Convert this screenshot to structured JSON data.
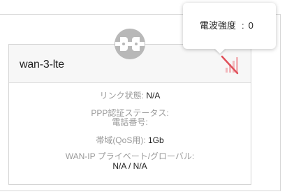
{
  "card": {
    "title": "wan-3-lte"
  },
  "info": {
    "link_status_label": "リンク状態:",
    "link_status_value": "N/A",
    "ppp_auth_label": "PPP認証ステータス:",
    "phone_number_label": "電話番号:",
    "bandwidth_label": "帯域(QoS用):",
    "bandwidth_value": "1Gb",
    "wan_ip_label": "WAN-IP プライベート/グローバル:",
    "wan_ip_value": "N/A / N/A"
  },
  "tooltip": {
    "label": "電波強度",
    "separator": ":",
    "value": "0"
  },
  "icons": {
    "signal": "signal-strength-disabled-icon",
    "connector": "plug-connector-icon"
  },
  "colors": {
    "signal_disabled": "#e0515b",
    "signal_bars": "#f2b8bc",
    "connector_gray": "#b8b8b8"
  }
}
